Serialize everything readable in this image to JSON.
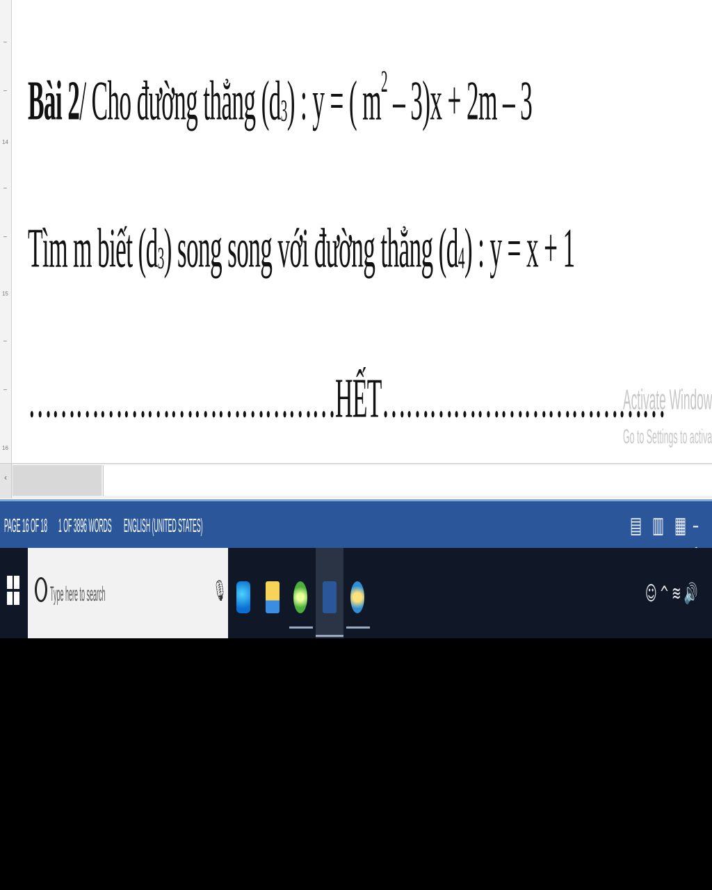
{
  "document": {
    "line1": {
      "bold": "Bài 2",
      "text_a": "/  Cho đường thẳng (d",
      "sub_a": "3",
      "text_b": ") : y = ( m",
      "sup": "2",
      "text_c": " – 3)x  + 2m – 3"
    },
    "line2": {
      "text_a": "Tìm m biết (d",
      "sub_a": "3",
      "text_b": ")  song song với đường thẳng (d",
      "sub_b": "4",
      "text_c": ") : y = x + 1"
    },
    "end_line": {
      "dots_left": "…………………………………",
      "word": "HẾT",
      "dots_right": "………………………………"
    },
    "watermark": {
      "title": "Activate Windows",
      "subtitle": "Go to Settings to activate Windows."
    }
  },
  "status_bar": {
    "page": "PAGE 16 OF 18",
    "words": "1 OF 3896 WORDS",
    "language": "ENGLISH (UNITED STATES)",
    "accent_color": "#2b579a"
  },
  "taskbar": {
    "search_placeholder": "Type here to search",
    "apps": [
      "edge-icon",
      "file-explorer-icon",
      "app-green-icon",
      "word-icon",
      "app-globe-icon"
    ],
    "tray_icons": [
      "person-icon",
      "chevron-up-icon",
      "network-icon",
      "volume-icon"
    ]
  }
}
